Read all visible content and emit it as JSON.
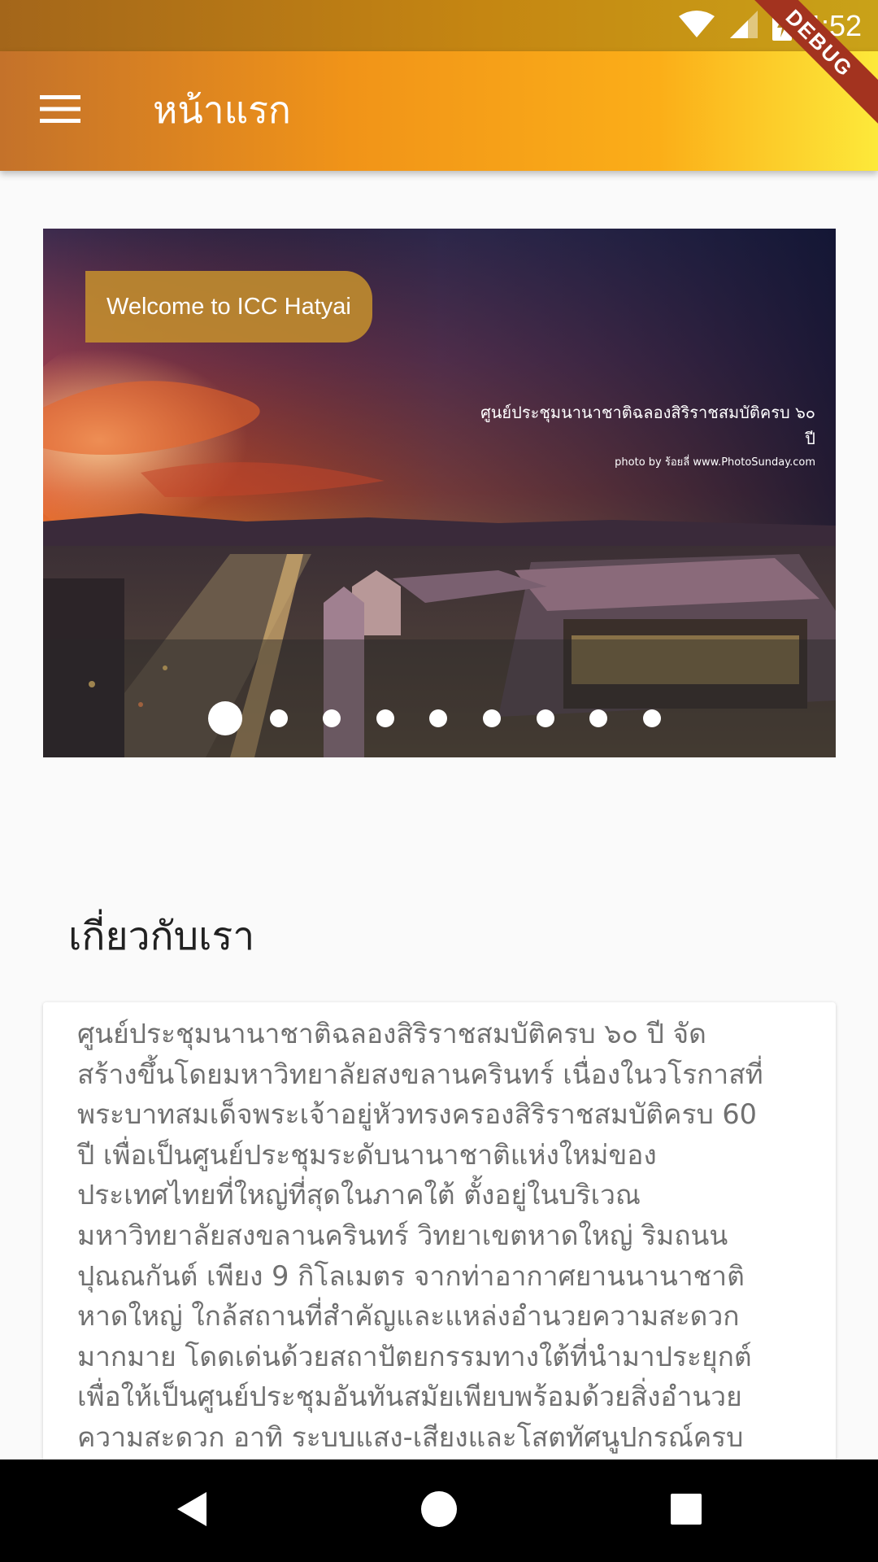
{
  "status_bar": {
    "time": "4:52",
    "icons": [
      "wifi-icon",
      "cell-signal-icon",
      "battery-charging-icon"
    ]
  },
  "debug_banner": "DEBUG",
  "app_bar": {
    "title": "หน้าแรก",
    "menu_icon": "hamburger-menu-icon",
    "gradient": [
      "#c4722a",
      "#f19418",
      "#fbae18",
      "#fde93a"
    ]
  },
  "carousel": {
    "caption": "Welcome to ICC Hatyai",
    "photo_credit_line1": "ศูนย์ประชุมนานาชาติฉลองสิริราชสมบัติครบ ๖๐ ปี",
    "photo_credit_line2": "photo by ร้อยลี่ www.PhotoSunday.com",
    "slide_count": 9,
    "active_slide": 1
  },
  "about": {
    "heading": "เกี่ยวกับเรา",
    "lines": [
      "ศูนย์ประชุมนานาชาติฉลองสิริราชสมบัติครบ ๖๐ ปี จัด",
      "สร้างขึ้นโดยมหาวิทยาลัยสงขลานครินทร์ เนื่องในวโรกาสที่",
      "พระบาทสมเด็จพระเจ้าอยู่หัวทรงครองสิริราชสมบัติครบ 60",
      "ปี เพื่อเป็นศูนย์ประชุมระดับนานาชาติแห่งใหม่ของ",
      "ประเทศไทยที่ใหญ่ที่สุดในภาคใต้ ตั้งอยู่ในบริเวณ",
      "มหาวิทยาลัยสงขลานครินทร์ วิทยาเขตหาดใหญ่ ริมถนน",
      "ปุณณกันต์ เพียง 9 กิโลเมตร จากท่าอากาศยานนานาชาติ",
      "หาดใหญ่ ใกล้สถานที่สำคัญและแหล่งอำนวยความสะดวก",
      "มากมาย โดดเด่นด้วยสถาปัตยกรรมทางใต้ที่นำมาประยุกต์",
      "เพื่อให้เป็นศูนย์ประชุมอันทันสมัยเพียบพร้อมด้วยสิ่งอำนวย",
      "ความสะดวก อาทิ ระบบแสง-เสียงและโสตทัศนูปกรณ์ครบ"
    ]
  },
  "nav_bar": {
    "buttons": [
      "back-icon",
      "home-icon",
      "recents-icon"
    ]
  }
}
